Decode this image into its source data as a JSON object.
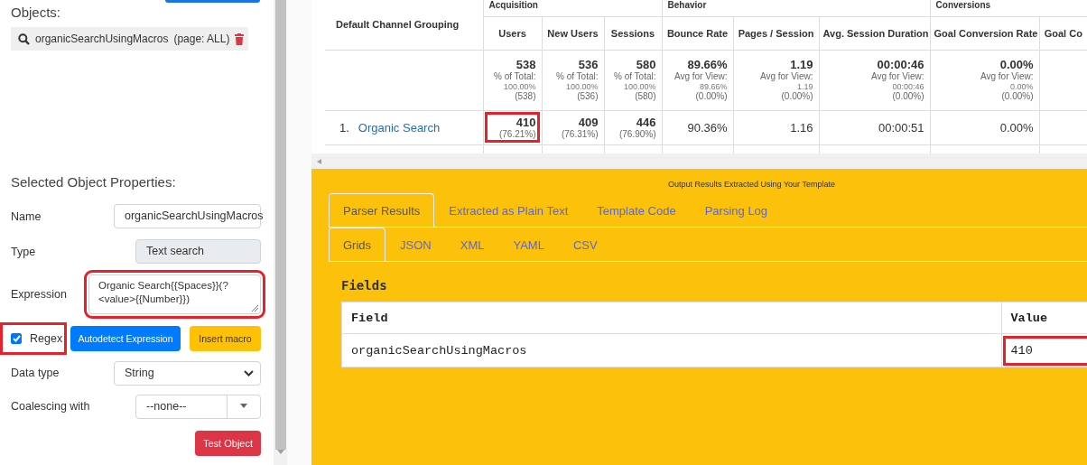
{
  "sidebar": {
    "objects_label": "Objects:",
    "objects": [
      {
        "name": "organicSearchUsingMacros",
        "scope": "(page: ALL)"
      }
    ],
    "properties_title": "Selected Object Properties:",
    "fields": [
      {
        "kind": "text",
        "label": "Name",
        "value": "organicSearchUsingMacros"
      },
      {
        "kind": "disabled",
        "label": "Type",
        "value": "Text search"
      },
      {
        "kind": "textarea",
        "label": "Expression",
        "value": "Organic Search{{Spaces}}(?<value>{{Number}})",
        "highlighted": true
      }
    ],
    "regex": {
      "label": "Regex",
      "checked": true,
      "highlighted": true
    },
    "buttons": [
      {
        "kind": "primary",
        "label": "Autodetect Expression"
      },
      {
        "kind": "warning",
        "label": "Insert macro"
      }
    ],
    "selects": [
      {
        "kind": "native",
        "label": "Data type",
        "value": "String"
      },
      {
        "kind": "combo",
        "label": "Coalescing with",
        "value": "--none--"
      }
    ],
    "test_button": "Test Object"
  },
  "report": {
    "channel_header": "Default Channel Grouping",
    "groups": [
      {
        "label": "Acquisition"
      },
      {
        "label": "Behavior"
      },
      {
        "label": "Conversions"
      }
    ],
    "columns": [
      "Users",
      "New Users",
      "Sessions",
      "Bounce Rate",
      "Pages / Session",
      "Avg. Session Duration",
      "Goal Conversion Rate",
      "Goal Co"
    ],
    "totals": [
      {
        "value": "538",
        "label": "% of Total:",
        "ref": "100.00%",
        "delta": "(538)"
      },
      {
        "value": "536",
        "label": "% of Total:",
        "ref": "100.00%",
        "delta": "(536)"
      },
      {
        "value": "580",
        "label": "% of Total:",
        "ref": "100.00%",
        "delta": "(580)"
      },
      {
        "value": "89.66%",
        "label": "Avg for View:",
        "ref": "89.66%",
        "delta": "(0.00%)"
      },
      {
        "value": "1.19",
        "label": "Avg for View:",
        "ref": "1.19",
        "delta": "(0.00%)"
      },
      {
        "value": "00:00:46",
        "label": "Avg for View:",
        "ref": "00:00:46",
        "delta": "(0.00%)"
      },
      {
        "value": "0.00%",
        "label": "Avg for View:",
        "ref": "0.00%",
        "delta": "(0.00%)"
      }
    ],
    "rows": [
      {
        "index": "1.",
        "channel": "Organic Search",
        "cells": [
          {
            "value": "410",
            "share": "(76.21%)",
            "highlighted": true
          },
          {
            "value": "409",
            "share": "(76.31%)",
            "highlighted": false
          },
          {
            "value": "446",
            "share": "(76.90%)",
            "highlighted": false
          },
          {
            "value": "90.36%",
            "highlighted": false
          },
          {
            "value": "1.16",
            "highlighted": false
          },
          {
            "value": "00:00:51",
            "highlighted": false
          },
          {
            "value": "0.00%",
            "highlighted": false
          }
        ]
      }
    ]
  },
  "output": {
    "title": "Output Results Extracted Using Your Template",
    "tabs": [
      {
        "label": "Parser Results",
        "selected": true
      },
      {
        "label": "Extracted as Plain Text",
        "selected": false
      },
      {
        "label": "Template Code",
        "selected": false
      },
      {
        "label": "Parsing Log",
        "selected": false
      }
    ],
    "subtabs": [
      {
        "label": "Grids",
        "selected": true
      },
      {
        "label": "JSON",
        "selected": false
      },
      {
        "label": "XML",
        "selected": false
      },
      {
        "label": "YAML",
        "selected": false
      },
      {
        "label": "CSV",
        "selected": false
      }
    ],
    "fields_title": "Fields",
    "columns": [
      "Field",
      "Value"
    ],
    "rows": [
      {
        "field": "organicSearchUsingMacros",
        "value": "410",
        "highlighted": true
      }
    ]
  }
}
